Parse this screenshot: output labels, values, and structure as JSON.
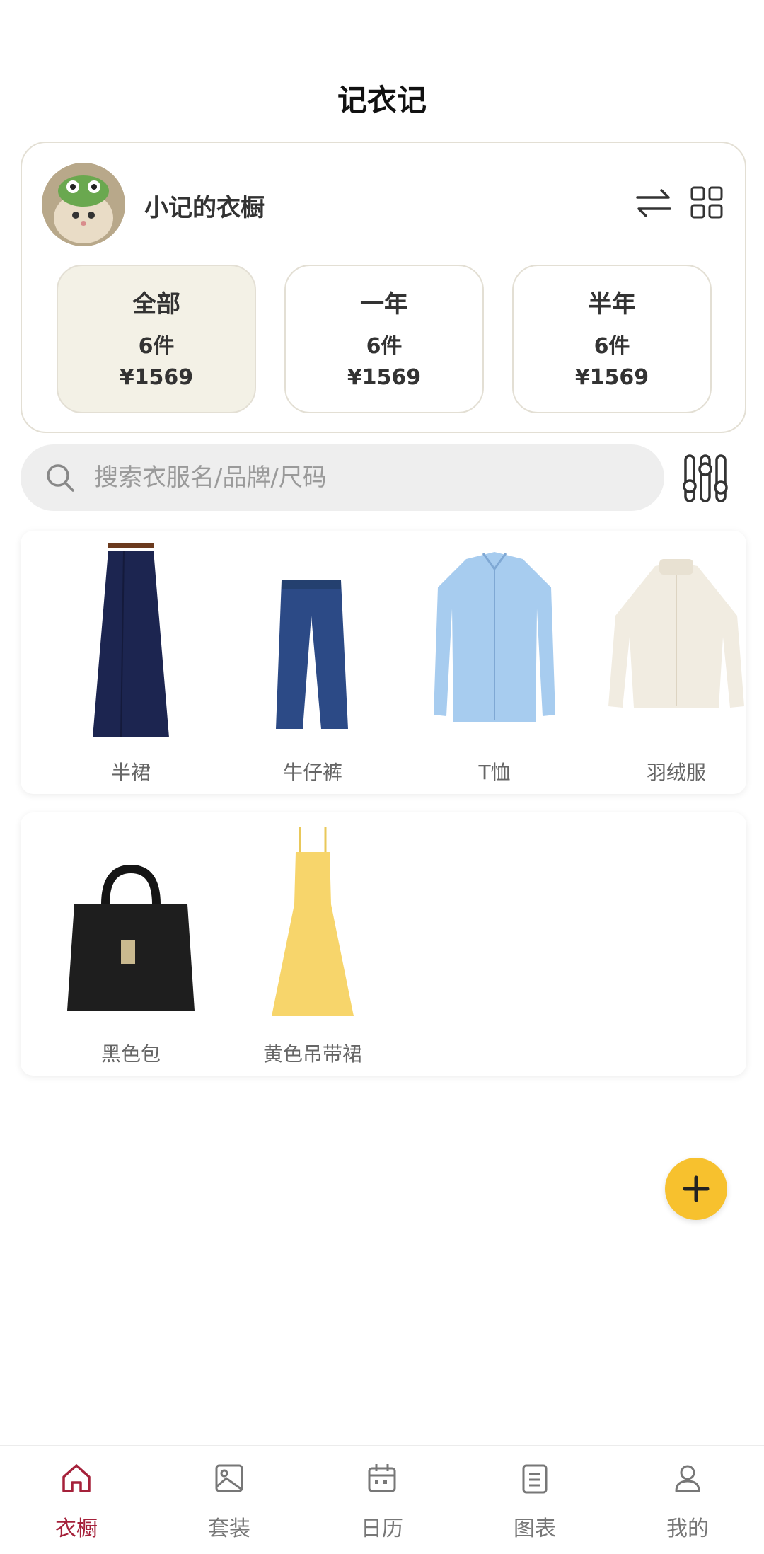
{
  "app": {
    "title": "记衣记"
  },
  "wardrobe": {
    "name": "小记的衣橱",
    "stats": [
      {
        "label": "全部",
        "count": "6件",
        "price": "¥1569",
        "active": true
      },
      {
        "label": "一年",
        "count": "6件",
        "price": "¥1569",
        "active": false
      },
      {
        "label": "半年",
        "count": "6件",
        "price": "¥1569",
        "active": false
      }
    ]
  },
  "search": {
    "placeholder": "搜索衣服名/品牌/尺码"
  },
  "categories": [
    {
      "label": "半裙",
      "icon": "navy-skirt"
    },
    {
      "label": "牛仔裤",
      "icon": "jeans"
    },
    {
      "label": "T恤",
      "icon": "blue-shirt"
    },
    {
      "label": "羽绒服",
      "icon": "cream-down-jacket"
    },
    {
      "label": "黑色包",
      "icon": "black-handbag"
    },
    {
      "label": "黄色吊带裙",
      "icon": "yellow-slip-dress"
    }
  ],
  "tabs": [
    {
      "label": "衣橱",
      "icon": "home-icon",
      "active": true
    },
    {
      "label": "套装",
      "icon": "image-icon",
      "active": false
    },
    {
      "label": "日历",
      "icon": "calendar-icon",
      "active": false
    },
    {
      "label": "图表",
      "icon": "clipboard-icon",
      "active": false
    },
    {
      "label": "我的",
      "icon": "user-icon",
      "active": false
    }
  ],
  "colors": {
    "accent": "#a5213a",
    "fab": "#f7c12e",
    "active_stat_bg": "#f3f1e6",
    "card_border": "#e3dfd4"
  }
}
